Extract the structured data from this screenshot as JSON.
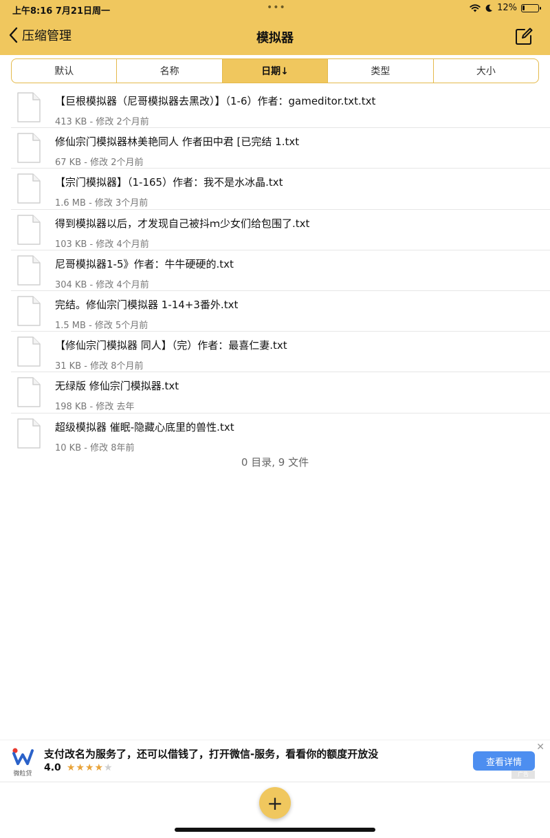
{
  "status_bar": {
    "time": "上午8:16  7月21日周一",
    "dots": "•••",
    "battery_percent": "12%",
    "battery_level": 0.12
  },
  "nav": {
    "back_label": "压缩管理",
    "title": "模拟器"
  },
  "sort_tabs": [
    {
      "label": "默认",
      "active": false
    },
    {
      "label": "名称",
      "active": false
    },
    {
      "label": "日期↓",
      "active": true
    },
    {
      "label": "类型",
      "active": false
    },
    {
      "label": "大小",
      "active": false
    }
  ],
  "files": [
    {
      "name": "【巨根模拟器（尼哥模拟器去黑改）】（1-6）作者：gameditor.txt.txt",
      "meta": "413 KB - 修改 2个月前"
    },
    {
      "name": "修仙宗门模拟器林美艳同人 作者田中君 [已完结 1.txt",
      "meta": "67 KB - 修改 2个月前"
    },
    {
      "name": "【宗门模拟器】（1-165）作者：我不是水冰晶.txt",
      "meta": "1.6 MB - 修改 3个月前"
    },
    {
      "name": "得到模拟器以后，才发现自己被抖ｍ少女们给包围了.txt",
      "meta": "103 KB - 修改 4个月前"
    },
    {
      "name": "尼哥模拟器1-5》作者：牛牛硬硬的.txt",
      "meta": "304 KB - 修改 4个月前"
    },
    {
      "name": "完结。修仙宗门模拟器 1-14+3番外.txt",
      "meta": "1.5 MB - 修改 5个月前"
    },
    {
      "name": "【修仙宗门模拟器 同人】（完）作者：最喜仁妻.txt",
      "meta": "31 KB - 修改 8个月前"
    },
    {
      "name": "无绿版 修仙宗门模拟器.txt",
      "meta": "198 KB - 修改 去年"
    },
    {
      "name": "超级模拟器 催眠-隐藏心底里的兽性.txt",
      "meta": "10 KB - 修改 8年前"
    }
  ],
  "summary": "0 目录, 9 文件",
  "ad": {
    "logo_label": "微粒贷",
    "text": "支付改名为服务了，还可以借钱了，打开微信-服务，看看你的额度开放没",
    "rating": "4.0",
    "stars_full": "★★★★",
    "stars_empty": "★",
    "button_label": "查看详情",
    "close": "✕",
    "corner_tag": "广告"
  },
  "fab_label": "+",
  "colors": {
    "accent": "#f0c75e",
    "ad_button": "#4d8ef0"
  }
}
